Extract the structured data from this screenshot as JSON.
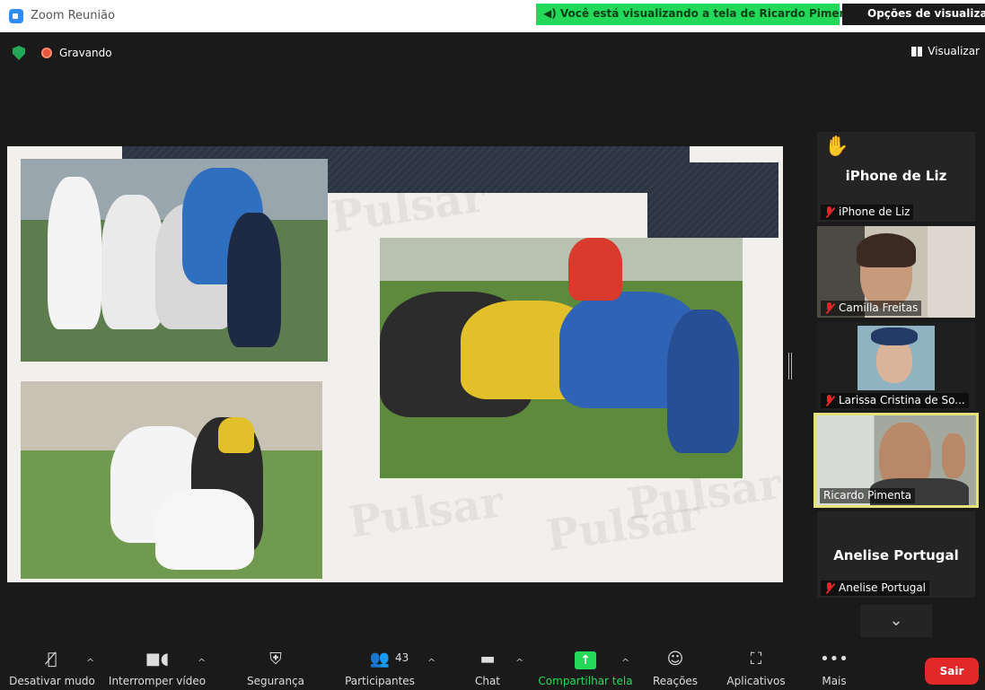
{
  "window": {
    "title": "Zoom Reunião"
  },
  "banner": {
    "sharing_text": "Você está visualizando a tela de Ricardo Pimenta",
    "view_options": "Opções de visualização"
  },
  "meeting": {
    "recording_label": "Gravando",
    "view_label": "Visualizar"
  },
  "shared_slide": {
    "watermark": "Pulsar"
  },
  "participants_panel": [
    {
      "name": "iPhone de Liz",
      "label": "iPhone de Liz",
      "muted": true,
      "hand_raised": true,
      "video": false
    },
    {
      "name": "Camilla Freitas",
      "label": "Camilla Freitas",
      "muted": true,
      "video": true
    },
    {
      "name": "Larissa Cristina de So...",
      "label": "Larissa Cristina de So...",
      "muted": true,
      "video": true
    },
    {
      "name": "Ricardo Pimenta",
      "label": "Ricardo Pimenta",
      "muted": false,
      "video": true,
      "active_speaker": true
    },
    {
      "name": "Anelise Portugal",
      "label": "Anelise Portugal",
      "muted": true,
      "video": false
    }
  ],
  "toolbar": {
    "mute": "Desativar mudo",
    "video": "Interromper vídeo",
    "security": "Segurança",
    "participants": "Participantes",
    "participants_count": "43",
    "chat": "Chat",
    "share": "Compartilhar tela",
    "reactions": "Reações",
    "apps": "Aplicativos",
    "more": "Mais",
    "leave": "Sair"
  },
  "colors": {
    "accent_green": "#23d959",
    "leave_red": "#e02828",
    "speaker_border": "#e6e27a"
  },
  "icons": [
    "zoom-icon",
    "shield-check-icon",
    "record-icon",
    "view-grid-icon",
    "hand-raise-icon",
    "mic-muted-icon",
    "camera-icon",
    "shield-icon",
    "participants-icon",
    "chat-icon",
    "share-arrow-icon",
    "emoji-icon",
    "apps-icon",
    "more-icon",
    "chevron-down-icon",
    "chevron-up-icon"
  ]
}
